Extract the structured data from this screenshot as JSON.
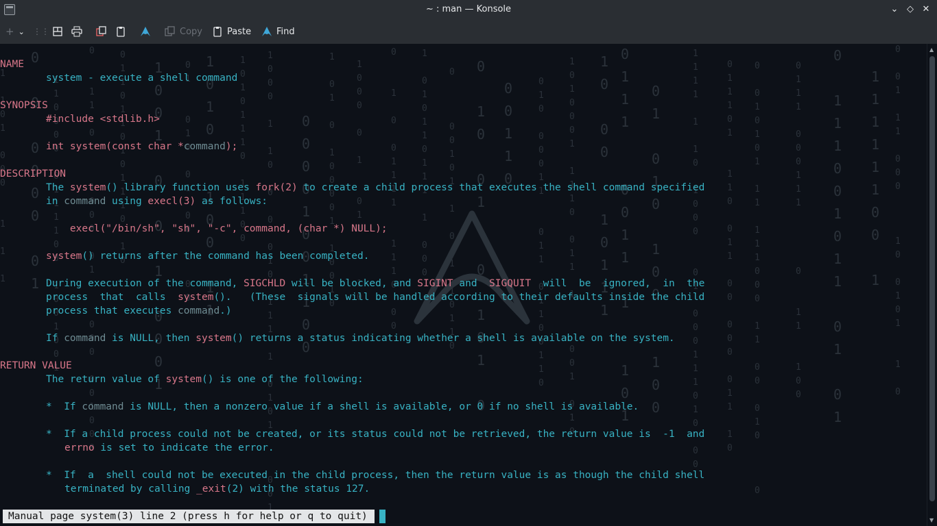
{
  "window": {
    "title": "~ : man — Konsole"
  },
  "toolbar": {
    "copy_label": "Copy",
    "paste_label": "Paste",
    "find_label": "Find"
  },
  "man": {
    "name_heading": "NAME",
    "name_line": "system - execute a shell command",
    "synopsis_heading": "SYNOPSIS",
    "include_line": "#include <stdlib.h>",
    "proto_prefix": "int system(const char *",
    "proto_arg": "command",
    "proto_suffix": ");",
    "description_heading": "DESCRIPTION",
    "d1": {
      "a": "The ",
      "b": "system",
      "c": "() library function uses ",
      "d": "fork(2)",
      "e": " to create a child process that executes the shell command specified"
    },
    "d2": {
      "a": "in ",
      "b": "command",
      "c": " using ",
      "d": "execl(3)",
      "e": " as follows:"
    },
    "d3": "    execl(\"/bin/sh\", \"sh\", \"-c\", command, (char *) NULL);",
    "d4": {
      "a": "system",
      "b": "() returns after the command has been completed."
    },
    "d5": {
      "a": "During execution of the command, ",
      "b": "SIGCHLD",
      "c": " will be blocked, and ",
      "d": "SIGINT",
      "e": " and  ",
      "f": "SIGQUIT",
      "g": "  will  be  ignored,  in  the"
    },
    "d6": {
      "a": "process  that  calls  ",
      "b": "system",
      "c": "().   (These  signals will be handled according to their defaults inside the child"
    },
    "d7": {
      "a": "process that executes ",
      "b": "command",
      "c": ".)"
    },
    "d8": {
      "a": "If ",
      "b": "command",
      "c": " is NULL, then ",
      "d": "system",
      "e": "() returns a status indicating whether a shell is available on the system."
    },
    "return_heading": "RETURN VALUE",
    "r1": {
      "a": "The return value of ",
      "b": "system",
      "c": "() is one of the following:"
    },
    "b1": {
      "a": "*  If ",
      "b": "command",
      "c": " is NULL, then a nonzero value if a shell is available, or 0 if no shell is available."
    },
    "b2": "*  If a child process could not be created, or its status could not be retrieved, the return value is  -1  and",
    "b2b": {
      "a": "errno",
      "b": " is set to indicate the error."
    },
    "b3": "*  If  a  shell could not be executed in the child process, then the return value is as though the child shell",
    "b3b": {
      "a": "terminated by calling ",
      "b": "_exit",
      "c": "(2) with the status 127."
    }
  },
  "status_line": "Manual page system(3) line 2 (press h for help or q to quit)",
  "colors": {
    "background": "#0d1118",
    "text_cyan": "#38b3c4",
    "heading_pink": "#d9778a",
    "dim_gray": "#6f8c93",
    "chrome": "#2a2e33"
  }
}
